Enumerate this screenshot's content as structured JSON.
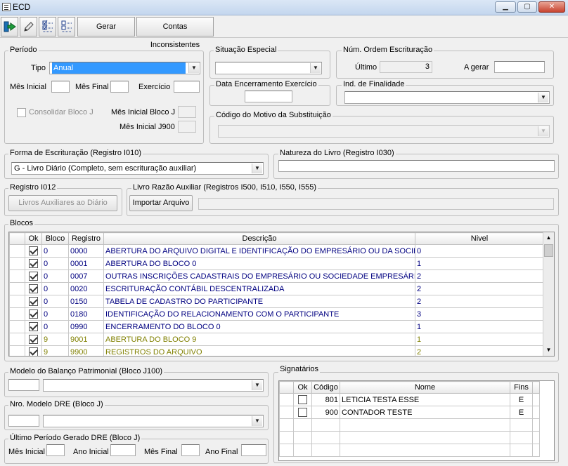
{
  "window": {
    "title": "ECD"
  },
  "toolbar": {
    "gerar_label": "Gerar",
    "contas_label": "Contas Inconsistentes"
  },
  "periodo": {
    "label": "Período",
    "tipo_label": "Tipo",
    "tipo_value": "Anual",
    "mes_inicial_label": "Mês Inicial",
    "mes_final_label": "Mês Final",
    "exercicio_label": "Exercício",
    "consolidar_label": "Consolidar Bloco J",
    "mes_inicial_bloco_j_label": "Mês Inicial Bloco J",
    "mes_inicial_j900_label": "Mês Inicial J900"
  },
  "situacao_especial": {
    "label": "Situação Especial",
    "value": ""
  },
  "num_ordem": {
    "label": "Núm. Ordem Escrituração",
    "ultimo_label": "Último",
    "ultimo_value": "3",
    "a_gerar_label": "A gerar",
    "a_gerar_value": ""
  },
  "data_encerramento": {
    "label": "Data Encerramento Exercício",
    "value": ""
  },
  "ind_finalidade": {
    "label": "Ind. de Finalidade",
    "value": ""
  },
  "codigo_motivo": {
    "label": "Código do Motivo da Substituição",
    "value": ""
  },
  "forma_escrituracao": {
    "label": "Forma de Escrituração (Registro I010)",
    "value": "G - Livro Diário (Completo, sem escrituração auxiliar)"
  },
  "natureza_livro": {
    "label": "Natureza do Livro (Registro I030)",
    "value": ""
  },
  "registro_i012": {
    "label": "Registro I012",
    "button_label": "Livros Auxiliares ao Diário"
  },
  "livro_razao": {
    "label": "Livro Razão Auxiliar (Registros I500, I510, I550, I555)",
    "button_label": "Importar Arquivo",
    "value": ""
  },
  "blocos": {
    "label": "Blocos",
    "columns": [
      "Ok",
      "Bloco",
      "Registro",
      "Descrição",
      "Nivel"
    ],
    "rows": [
      {
        "ok": true,
        "bloco": "0",
        "registro": "0000",
        "descricao": "ABERTURA DO ARQUIVO DIGITAL E IDENTIFICAÇÃO DO EMPRESÁRIO OU DA SOCIEDADE EMPRESÁRIA",
        "nivel": "0",
        "color": "navy"
      },
      {
        "ok": true,
        "bloco": "0",
        "registro": "0001",
        "descricao": "ABERTURA DO BLOCO 0",
        "nivel": "1",
        "color": "navy"
      },
      {
        "ok": true,
        "bloco": "0",
        "registro": "0007",
        "descricao": "OUTRAS INSCRIÇÕES CADASTRAIS DO EMPRESÁRIO OU SOCIEDADE EMPRESÁRIA",
        "nivel": "2",
        "color": "navy"
      },
      {
        "ok": true,
        "bloco": "0",
        "registro": "0020",
        "descricao": "ESCRITURAÇÃO CONTÁBIL DESCENTRALIZADA",
        "nivel": "2",
        "color": "navy"
      },
      {
        "ok": true,
        "bloco": "0",
        "registro": "0150",
        "descricao": "TABELA DE CADASTRO DO PARTICIPANTE",
        "nivel": "2",
        "color": "navy"
      },
      {
        "ok": true,
        "bloco": "0",
        "registro": "0180",
        "descricao": "IDENTIFICAÇÃO DO RELACIONAMENTO COM O PARTICIPANTE",
        "nivel": "3",
        "color": "navy"
      },
      {
        "ok": true,
        "bloco": "0",
        "registro": "0990",
        "descricao": "ENCERRAMENTO DO BLOCO 0",
        "nivel": "1",
        "color": "navy"
      },
      {
        "ok": true,
        "bloco": "9",
        "registro": "9001",
        "descricao": "ABERTURA DO BLOCO 9",
        "nivel": "1",
        "color": "olive"
      },
      {
        "ok": true,
        "bloco": "9",
        "registro": "9900",
        "descricao": "REGISTROS DO ARQUIVO",
        "nivel": "2",
        "color": "olive"
      }
    ]
  },
  "modelo_balanco": {
    "label": "Modelo do Balanço Patrimonial (Bloco J100)",
    "code": "",
    "value": ""
  },
  "modelo_dre": {
    "label": "Nro. Modelo DRE (Bloco J)",
    "code": "",
    "value": ""
  },
  "ultimo_periodo": {
    "label": "Último Período Gerado DRE (Bloco J)",
    "mes_inicial_label": "Mês Inicial",
    "ano_inicial_label": "Ano Inicial",
    "mes_final_label": "Mês Final",
    "ano_final_label": "Ano Final"
  },
  "signatarios": {
    "label": "Signatários",
    "columns": [
      "Ok",
      "Código",
      "Nome",
      "Fins"
    ],
    "rows": [
      {
        "ok": false,
        "codigo": "801",
        "nome": "LETICIA TESTA ESSE",
        "fins": "E"
      },
      {
        "ok": false,
        "codigo": "900",
        "nome": "CONTADOR TESTE",
        "fins": "E"
      }
    ]
  }
}
